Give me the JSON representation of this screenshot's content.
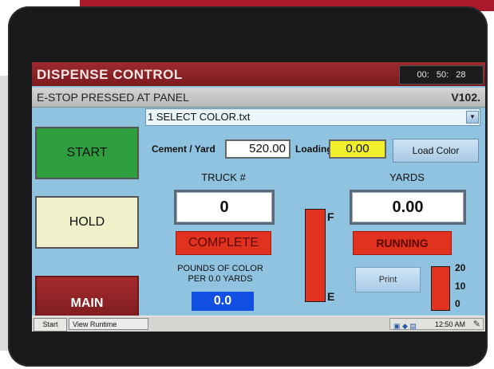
{
  "window": {
    "title": "DISPENSE CONTROL",
    "clock": "00: 50: 28"
  },
  "status_bar": {
    "message": "E-STOP PRESSED AT PANEL",
    "version": "V102."
  },
  "buttons": {
    "start": "START",
    "hold": "HOLD",
    "main": "MAIN",
    "load_color": "Load Color",
    "print": "Print"
  },
  "color_select": {
    "value": "1 SELECT COLOR.txt"
  },
  "cement": {
    "label": "Cement / Yard",
    "value": "520.00"
  },
  "loading": {
    "label": "Loading",
    "value": "0.00"
  },
  "truck": {
    "label": "TRUCK #",
    "value": "0",
    "status": "COMPLETE"
  },
  "yards": {
    "label": "YARDS",
    "value": "0.00",
    "status": "RUNNING"
  },
  "pounds": {
    "label_line1": "POUNDS OF COLOR",
    "label_line2": "PER 0.0 YARDS",
    "value": "0.0"
  },
  "tank_gauge": {
    "full_label": "F",
    "empty_label": "E"
  },
  "small_gauge": {
    "scale_top": "20",
    "scale_mid": "10",
    "scale_bottom": "0"
  },
  "taskbar": {
    "start": "Start",
    "item": "View Runtime",
    "time": "12:50 AM"
  },
  "colors": {
    "screen_bg": "#8fc3df",
    "title_bar": "#8b2226",
    "start_green": "#2f9e3f",
    "hold_yellow": "#eef0c9",
    "status_red": "#e0321e",
    "loading_yellow": "#f2ef2d",
    "pounds_blue": "#1150e0"
  }
}
